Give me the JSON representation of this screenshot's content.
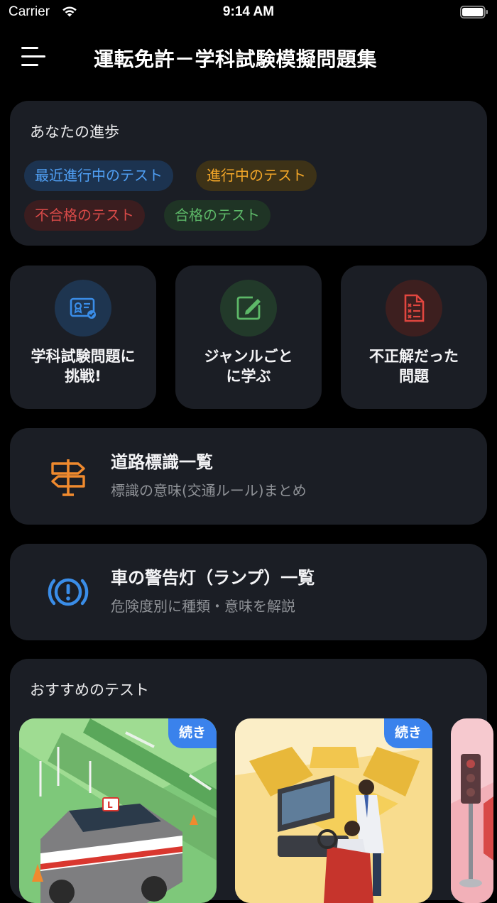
{
  "status_bar": {
    "carrier": "Carrier",
    "time": "9:14 AM"
  },
  "header": {
    "title": "運転免許－学科試験模擬問題集",
    "menu_icon": "hamburger-menu-icon"
  },
  "progress": {
    "title": "あなたの進歩",
    "chips": [
      {
        "label": "最近進行中のテスト",
        "color": "#4f9ef2"
      },
      {
        "label": "進行中のテスト",
        "color": "#f2a628"
      },
      {
        "label": "不合格のテスト",
        "color": "#d84a48"
      },
      {
        "label": "合格のテスト",
        "color": "#5db868"
      }
    ]
  },
  "tiles": [
    {
      "label_line1": "学科試験問題に",
      "label_line2": "挑戦!",
      "icon": "certificate-icon",
      "color": "#3a8de8"
    },
    {
      "label_line1": "ジャンルごと",
      "label_line2": "に学ぶ",
      "icon": "edit-note-icon",
      "color": "#5db868"
    },
    {
      "label_line1": "不正解だった",
      "label_line2": "問題",
      "icon": "wrong-answers-document-icon",
      "color": "#e0463f"
    }
  ],
  "road_signs": {
    "title": "道路標識一覧",
    "subtitle": "標識の意味(交通ルール)まとめ",
    "icon": "signpost-icon",
    "color": "#f08a2e"
  },
  "warning_lamps": {
    "title": "車の警告灯（ランプ）一覧",
    "subtitle": "危険度別に種類・意味を解説",
    "icon": "brake-warning-icon",
    "color": "#3a8de8"
  },
  "recommended": {
    "title": "おすすめのテスト",
    "items": [
      {
        "badge": "続き",
        "image": "driving-school-car-illustration"
      },
      {
        "badge": "続き",
        "image": "driving-simulator-illustration"
      },
      {
        "badge": "",
        "image": "traffic-light-illustration"
      }
    ]
  },
  "colors": {
    "background": "#000000",
    "card": "#1b1e25",
    "accent": "#3a82ec"
  }
}
